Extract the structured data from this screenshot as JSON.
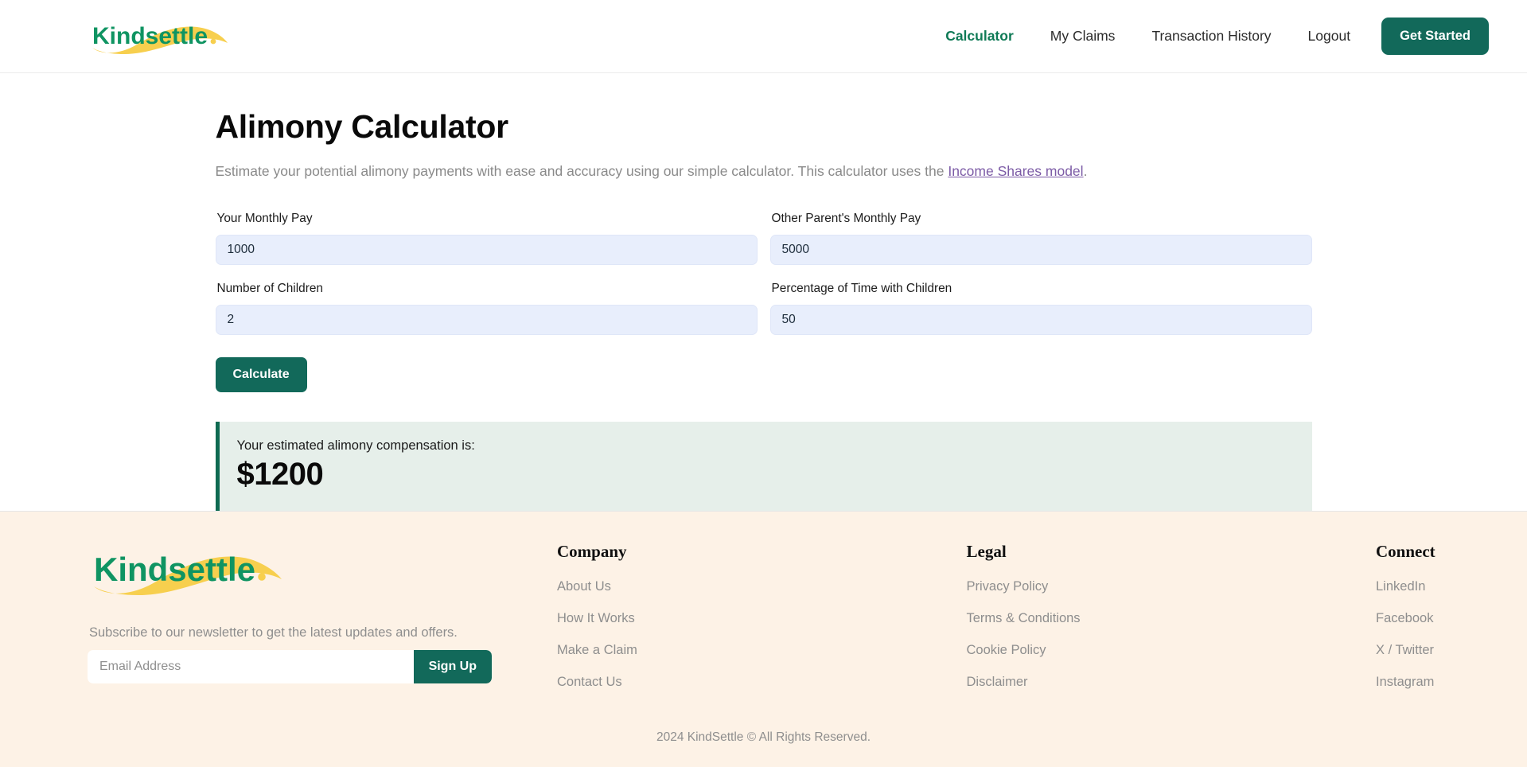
{
  "header": {
    "logo_text": "Kindsettle",
    "logo_dot": ".",
    "nav": [
      {
        "label": "Calculator",
        "active": true
      },
      {
        "label": "My Claims",
        "active": false
      },
      {
        "label": "Transaction History",
        "active": false
      },
      {
        "label": "Logout",
        "active": false
      }
    ],
    "cta_label": "Get Started"
  },
  "main": {
    "title": "Alimony Calculator",
    "description_before": "Estimate your potential alimony payments with ease and accuracy using our simple calculator. This calculator uses the ",
    "description_link": "Income Shares model",
    "description_after": ".",
    "fields": [
      {
        "label": "Your Monthly Pay",
        "value": "1000",
        "placeholder": ""
      },
      {
        "label": "Other Parent's Monthly Pay",
        "value": "5000",
        "placeholder": ""
      },
      {
        "label": "Number of Children",
        "value": "2",
        "placeholder": ""
      },
      {
        "label": "Percentage of Time with Children",
        "value": "50",
        "placeholder": ""
      }
    ],
    "calculate_label": "Calculate",
    "result_label": "Your estimated alimony compensation is:",
    "result_amount": "$1200"
  },
  "footer": {
    "logo_text": "Kindsettle",
    "logo_dot": ".",
    "newsletter_tagline": "Subscribe to our newsletter to get the latest updates and offers.",
    "newsletter_placeholder": "Email Address",
    "newsletter_value": "",
    "signup_label": "Sign Up",
    "columns": [
      {
        "title": "Company",
        "links": [
          "About Us",
          "How It Works",
          "Make a Claim",
          "Contact Us"
        ]
      },
      {
        "title": "Legal",
        "links": [
          "Privacy Policy",
          "Terms & Conditions",
          "Cookie Policy",
          "Disclaimer"
        ]
      },
      {
        "title": "Connect",
        "links": [
          "LinkedIn",
          "Facebook",
          "X / Twitter",
          "Instagram"
        ]
      }
    ],
    "copyright": "2024 KindSettle © All Rights Reserved."
  },
  "colors": {
    "brand_green": "#12695a",
    "logo_green": "#0f9462",
    "logo_yellow": "#f7cf4e",
    "accent_link": "#7c5ba6",
    "footer_bg": "#fdf2e6",
    "input_bg": "#e8eefc",
    "result_bg": "#e6efea"
  }
}
